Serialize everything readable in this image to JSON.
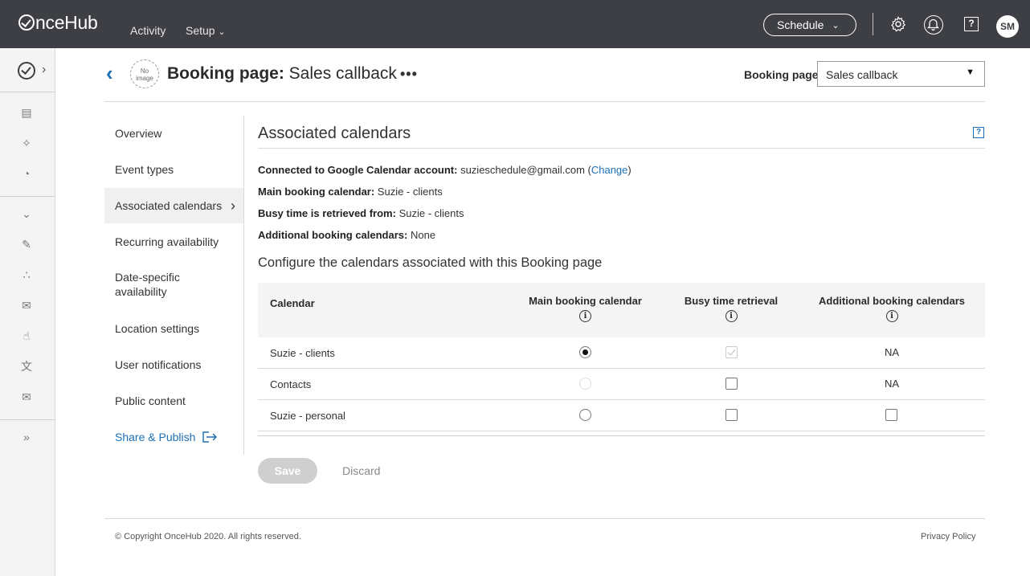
{
  "topbar": {
    "logo_text": "nceHub",
    "nav": {
      "activity": "Activity",
      "setup": "Setup"
    },
    "schedule_label": "Schedule",
    "help_label": "?",
    "avatar_initials": "SM"
  },
  "header": {
    "no_image_line1": "No",
    "no_image_line2": "image",
    "title_bold": "Booking page:",
    "title_rest": " Sales callback",
    "more": "•••",
    "selector_label": "Booking page",
    "selector_value": "Sales callback"
  },
  "sidenav": {
    "items": [
      {
        "label": "Overview"
      },
      {
        "label": "Event types"
      },
      {
        "label": "Associated calendars"
      },
      {
        "label": "Recurring availability"
      },
      {
        "label": "Date-specific availability"
      },
      {
        "label": "Location settings"
      },
      {
        "label": "User notifications"
      },
      {
        "label": "Public content"
      },
      {
        "label": "Share & Publish"
      }
    ]
  },
  "main": {
    "title": "Associated calendars",
    "help_label": "?",
    "info": {
      "connected_label": "Connected to Google Calendar account:",
      "connected_value": " suzieschedule@gmail.com (",
      "change_link": "Change",
      "connected_close": ")",
      "main_label": "Main booking calendar:",
      "main_value": " Suzie - clients",
      "busy_label": "Busy time is retrieved from:",
      "busy_value": " Suzie - clients",
      "additional_label": "Additional booking calendars:",
      "additional_value": " None"
    },
    "subtitle": "Configure the calendars associated with this Booking page",
    "table": {
      "headers": {
        "calendar": "Calendar",
        "main": "Main booking calendar",
        "busy": "Busy time retrieval",
        "additional": "Additional booking calendars",
        "info_glyph": "i"
      },
      "rows": [
        {
          "name": "Suzie - clients",
          "main": "checked",
          "busy": "checked-disabled",
          "additional": "NA"
        },
        {
          "name": "Contacts",
          "main": "disabled",
          "busy": "unchecked",
          "additional": "NA"
        },
        {
          "name": "Suzie - personal",
          "main": "unchecked",
          "busy": "unchecked",
          "additional": "unchecked"
        }
      ]
    },
    "save_label": "Save",
    "discard_label": "Discard"
  },
  "footer": {
    "copyright": "© Copyright OnceHub 2020. All rights reserved.",
    "privacy": "Privacy Policy"
  },
  "colors": {
    "topbar": "#3d3f44",
    "link": "#1c6fb6"
  }
}
